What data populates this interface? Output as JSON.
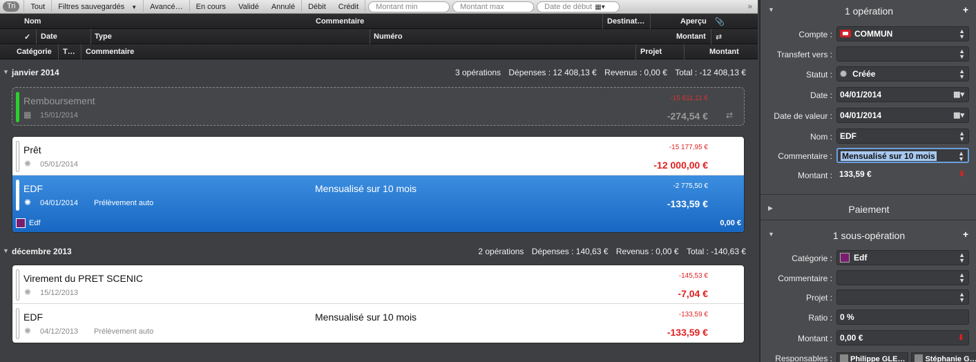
{
  "filterbar": {
    "sort": "Tri",
    "items": [
      "Tout",
      "Filtres sauvegardés",
      "Avancé…",
      "En cours",
      "Validé",
      "Annulé",
      "Débit",
      "Crédit"
    ],
    "montant_min_placeholder": "Montant min",
    "montant_max_placeholder": "Montant max",
    "date_debut_placeholder": "Date de début"
  },
  "header1": {
    "nom": "Nom",
    "commentaire": "Commentaire",
    "destinat": "Destinat…",
    "apercu": "Aperçu"
  },
  "header2": {
    "check": "✓",
    "date": "Date",
    "type": "Type",
    "numero": "Numéro",
    "montant": "Montant"
  },
  "header3": {
    "categorie": "Catégorie",
    "t": "T…",
    "commentaire": "Commentaire",
    "projet": "Projet",
    "montant": "Montant"
  },
  "groups": [
    {
      "name": "janvier 2014",
      "operations_count": "3 opérations",
      "depenses": "Dépenses : 12 408,13 €",
      "revenus": "Revenus : 0,00 €",
      "total": "Total : -12 408,13 €"
    },
    {
      "name": "décembre 2013",
      "operations_count": "2 opérations",
      "depenses": "Dépenses : 140,63 €",
      "revenus": "Revenus : 0,00 €",
      "total": "Total : -140,63 €"
    }
  ],
  "ghost_op": {
    "title": "Remboursement",
    "date": "15/01/2014",
    "balance": "-15 611,11 €",
    "amount": "-274,54 €"
  },
  "jan_ops": [
    {
      "title": "Prêt",
      "date": "05/01/2014",
      "type": "",
      "comment": "",
      "balance": "-15 177,95 €",
      "amount": "-12 000,00 €"
    },
    {
      "title": "EDF",
      "date": "04/01/2014",
      "type": "Prélèvement auto",
      "comment": "Mensualisé sur 10 mois",
      "balance": "-2 775,50 €",
      "amount": "-133,59 €",
      "sub_name": "Edf",
      "sub_amount": "0,00 €"
    }
  ],
  "dec_ops": [
    {
      "title": "Virement du PRET SCENIC",
      "date": "15/12/2013",
      "type": "",
      "comment": "",
      "balance": "-145,53 €",
      "amount": "-7,04 €"
    },
    {
      "title": "EDF",
      "date": "04/12/2013",
      "type": "Prélèvement auto",
      "comment": "Mensualisé sur 10 mois",
      "balance": "-133,59 €",
      "amount": "-133,59 €"
    }
  ],
  "inspector": {
    "section1": "1 opération",
    "compte_label": "Compte :",
    "compte_value": "COMMUN",
    "transfert_label": "Transfert vers :",
    "transfert_value": "",
    "statut_label": "Statut :",
    "statut_value": "Créée",
    "date_label": "Date :",
    "date_value": "04/01/2014",
    "date_valeur_label": "Date de valeur :",
    "date_valeur_value": "04/01/2014",
    "nom_label": "Nom :",
    "nom_value": "EDF",
    "commentaire_label": "Commentaire :",
    "commentaire_value": "Mensualisé sur 10 mois",
    "montant_label": "Montant :",
    "montant_value": "133,59 €",
    "section2": "Paiement",
    "section3": "1 sous-opération",
    "categorie_label": "Catégorie :",
    "categorie_value": "Edf",
    "sub_commentaire_label": "Commentaire :",
    "projet_label": "Projet :",
    "ratio_label": "Ratio :",
    "ratio_value": "0 %",
    "sub_montant_label": "Montant :",
    "sub_montant_value": "0,00 €",
    "responsables_label": "Responsables :",
    "responsables": [
      "Philippe GLE…",
      "Stéphanie G…"
    ]
  },
  "colors": {
    "selected": "#1f73d0",
    "negative": "#e02020",
    "category": "#7a1d6e",
    "status_green": "#2bd02b"
  }
}
